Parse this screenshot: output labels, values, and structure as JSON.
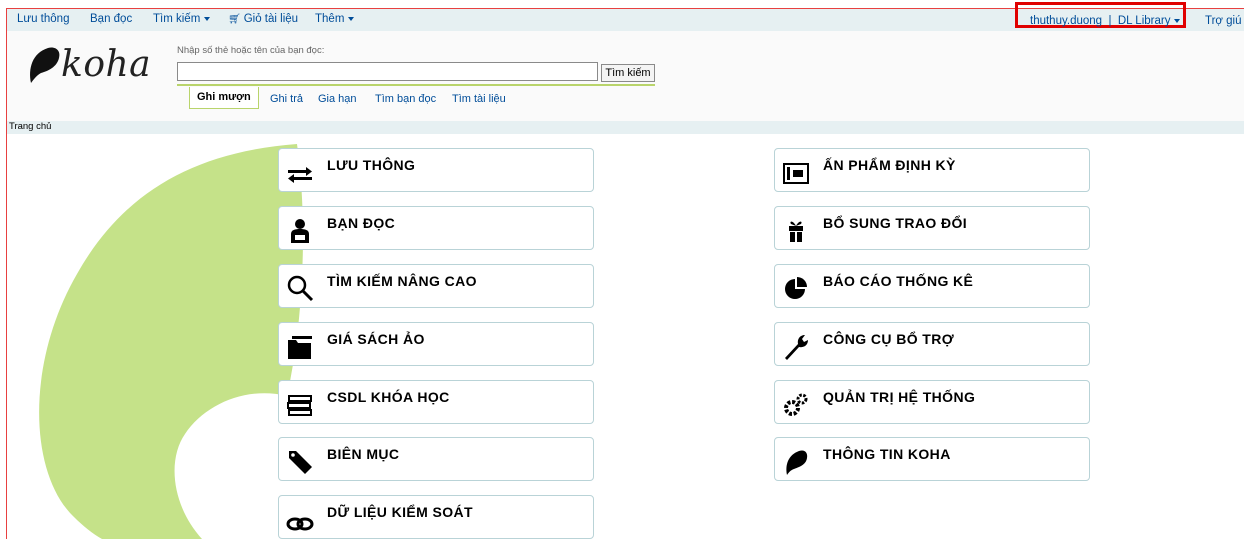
{
  "topnav": {
    "items": [
      {
        "label": "Lưu thông"
      },
      {
        "label": "Bạn đọc"
      },
      {
        "label": "Tìm kiếm"
      },
      {
        "label": "Giỏ tài liệu"
      },
      {
        "label": "Thêm"
      }
    ],
    "user": "thuthuy.duong",
    "separator": "|",
    "library": "DL Library",
    "help": "Trợ giú"
  },
  "header": {
    "logo_text": "koha",
    "search_label": "Nhập số thẻ hoặc tên của bạn đọc:",
    "search_value": "",
    "search_button": "Tìm kiếm",
    "tabs": [
      {
        "label": "Ghi mượn",
        "active": true
      },
      {
        "label": "Ghi trả"
      },
      {
        "label": "Gia hạn"
      },
      {
        "label": "Tìm bạn đọc"
      },
      {
        "label": "Tìm tài liệu"
      }
    ]
  },
  "breadcrumb": "Trang chủ",
  "colors": {
    "link": "#004d99",
    "highlight": "#e00000",
    "leaf": "#c5e289",
    "button_border": "#b9d3d7"
  },
  "modules_left": [
    {
      "label": "LƯU THÔNG",
      "icon": "exchange-arrows-icon"
    },
    {
      "label": "BẠN ĐỌC",
      "icon": "user-reading-icon"
    },
    {
      "label": "TÌM KIẾM NÂNG CAO",
      "icon": "magnifier-icon"
    },
    {
      "label": "GIÁ SÁCH ẢO",
      "icon": "folder-icon"
    },
    {
      "label": "CSDL KHÓA HỌC",
      "icon": "book-stack-icon"
    },
    {
      "label": "BIÊN MỤC",
      "icon": "tag-icon"
    },
    {
      "label": "DỮ LIỆU KIỂM SOÁT",
      "icon": "chain-link-icon"
    }
  ],
  "modules_right": [
    {
      "label": "ẤN PHẨM ĐỊNH KỲ",
      "icon": "newspaper-icon"
    },
    {
      "label": "BỔ SUNG TRAO ĐỔI",
      "icon": "gift-icon"
    },
    {
      "label": "BÁO CÁO THỐNG KÊ",
      "icon": "pie-chart-icon"
    },
    {
      "label": "CÔNG CỤ BỔ TRỢ",
      "icon": "wrench-icon"
    },
    {
      "label": "QUẢN TRỊ HỆ THỐNG",
      "icon": "gears-icon"
    },
    {
      "label": "THÔNG TIN KOHA",
      "icon": "koha-leaf-icon"
    }
  ]
}
